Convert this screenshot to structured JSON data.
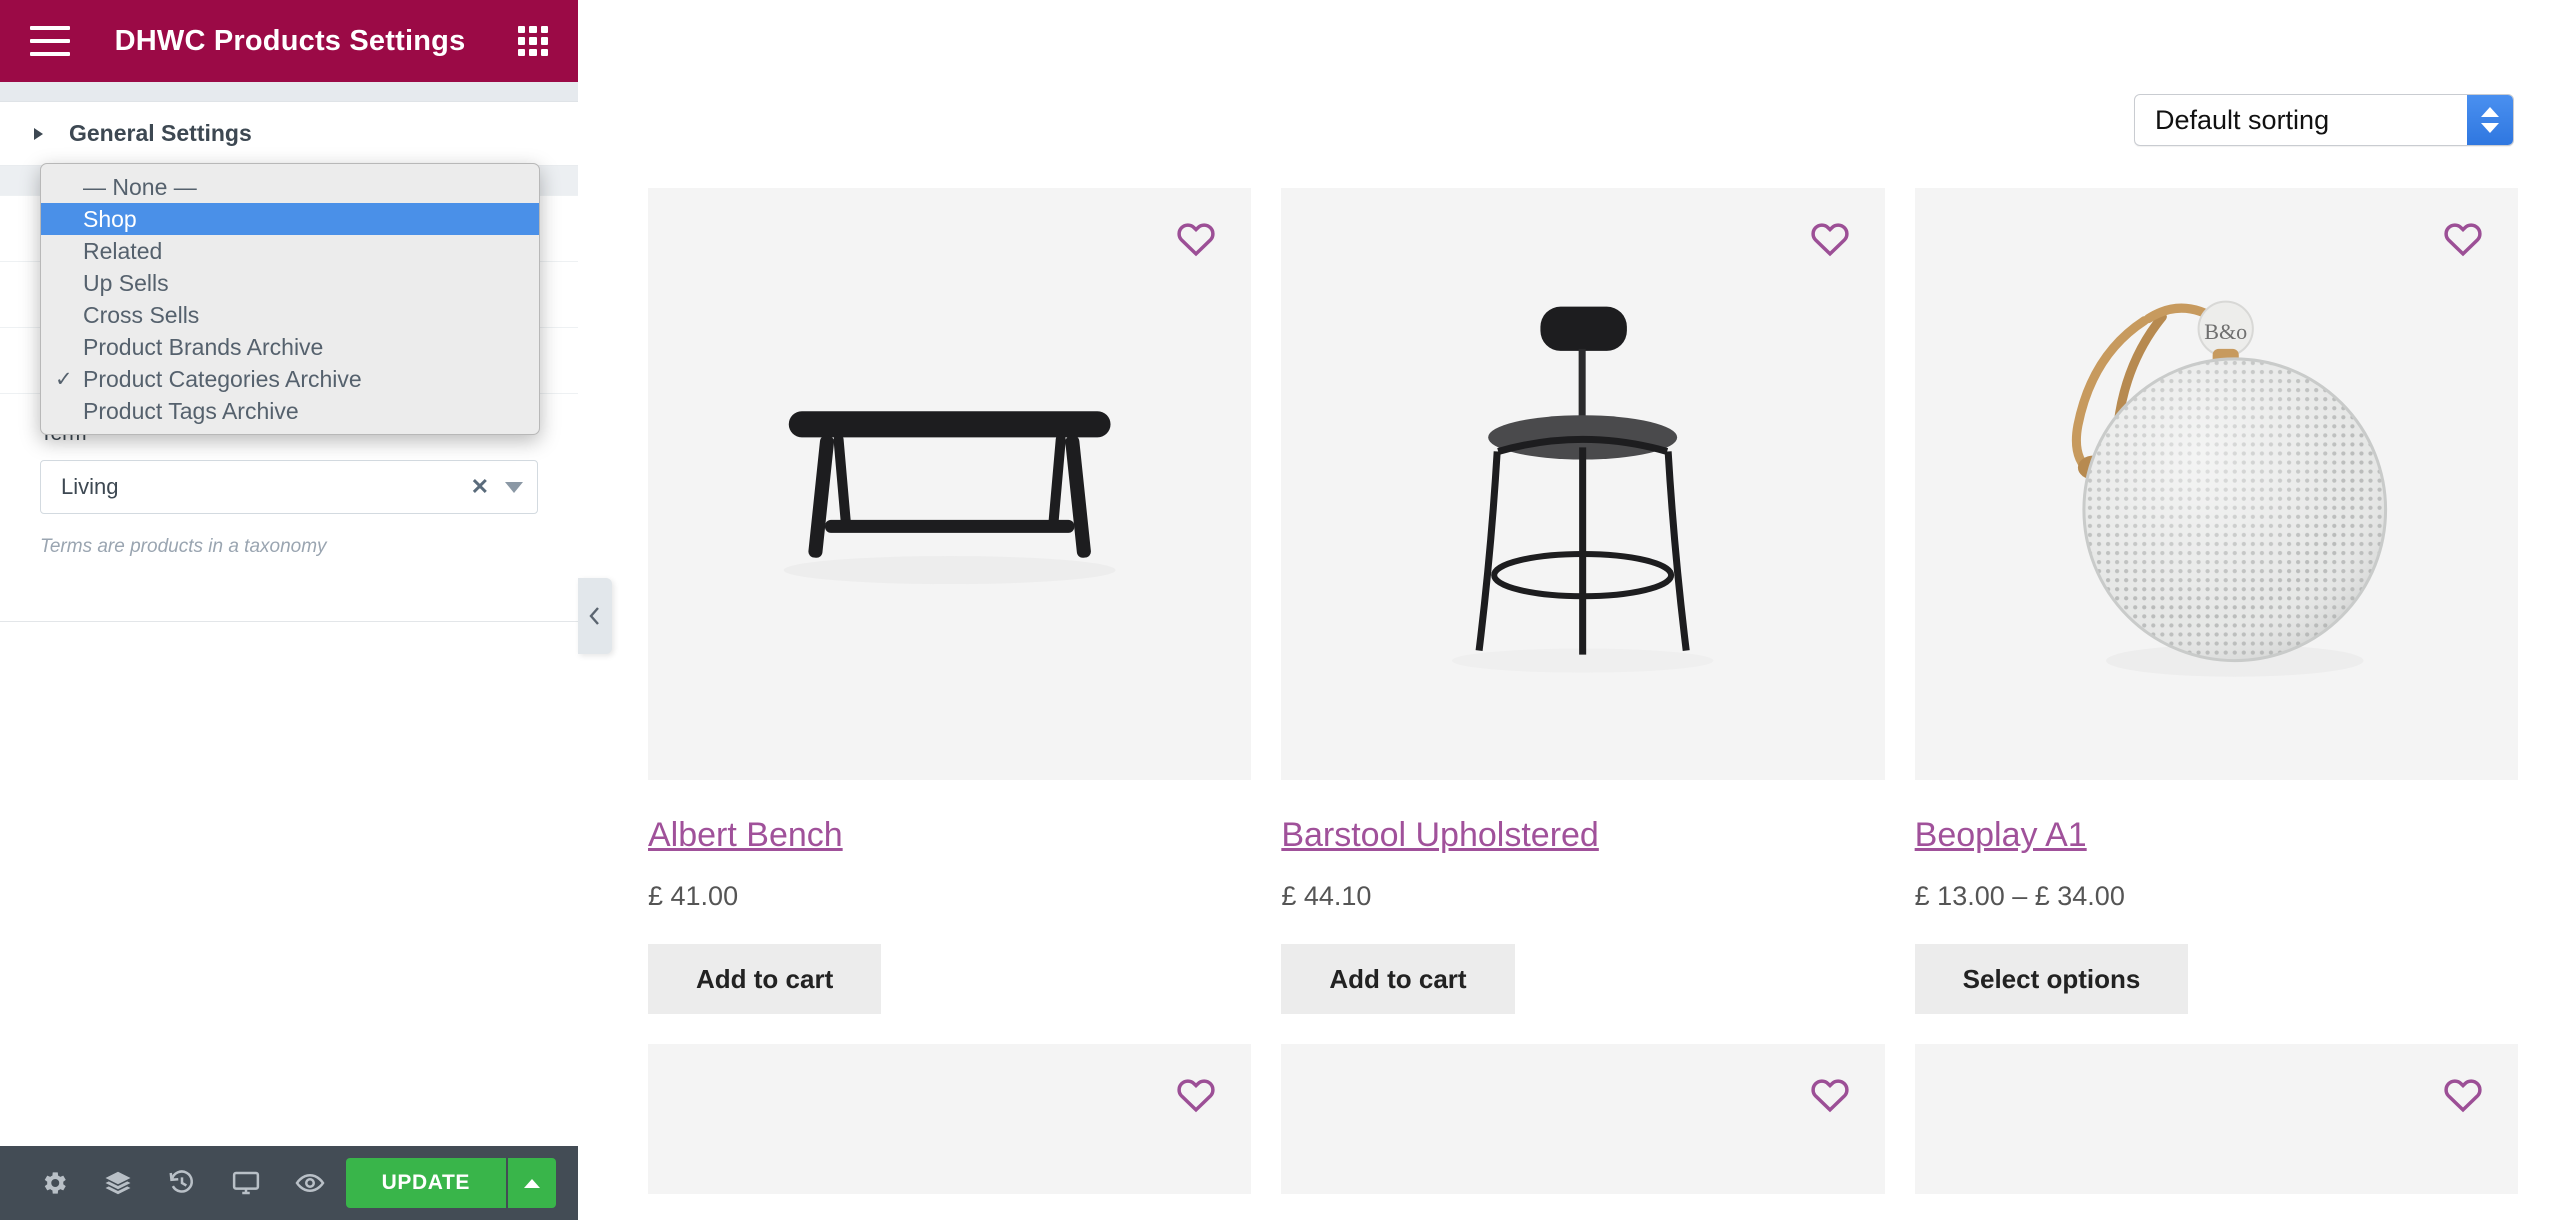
{
  "panel": {
    "header": {
      "title": "DHWC Products Settings",
      "menu_icon": "hamburger-icon",
      "apps_icon": "grid-apps-icon"
    },
    "section": {
      "title": "General Settings",
      "caret_icon": "caret-right-icon"
    },
    "source_dropdown": {
      "options": [
        {
          "label": "— None —",
          "selected": false,
          "checked": false
        },
        {
          "label": "Shop",
          "selected": true,
          "checked": false
        },
        {
          "label": "Related",
          "selected": false,
          "checked": false
        },
        {
          "label": "Up Sells",
          "selected": false,
          "checked": false
        },
        {
          "label": "Cross Sells",
          "selected": false,
          "checked": false
        },
        {
          "label": "Product Brands Archive",
          "selected": false,
          "checked": false
        },
        {
          "label": "Product Categories Archive",
          "selected": false,
          "checked": true
        },
        {
          "label": "Product Tags Archive",
          "selected": false,
          "checked": false
        }
      ],
      "check_glyph": "✓"
    },
    "term_field": {
      "label": "Term",
      "value": "Living",
      "clear_glyph": "✕",
      "help": "Terms are products in a taxonomy"
    },
    "collapse_handle_icon": "chevron-left-icon",
    "footer": {
      "tools": [
        {
          "name": "settings-gear-icon"
        },
        {
          "name": "layers-icon"
        },
        {
          "name": "history-icon"
        },
        {
          "name": "responsive-monitor-icon"
        },
        {
          "name": "preview-eye-icon"
        }
      ],
      "update_label": "UPDATE",
      "update_caret_icon": "caret-up-icon"
    },
    "accent_color": "#9b0a46",
    "update_color": "#39b54a"
  },
  "preview": {
    "sorting": {
      "value": "Default sorting",
      "stepper_icon": "stepper-updown-icon"
    },
    "wishlist_icon": "heart-icon",
    "products": [
      {
        "name": "Albert Bench",
        "price": "£ 41.00",
        "button": "Add to cart",
        "art": "bench"
      },
      {
        "name": "Barstool Upholstered",
        "price": "£ 44.10",
        "button": "Add to cart",
        "art": "barstool"
      },
      {
        "name": "Beoplay A1",
        "price": "£ 13.00 – £ 34.00",
        "button": "Select options",
        "art": "speaker"
      }
    ],
    "link_color": "#a0519a"
  }
}
